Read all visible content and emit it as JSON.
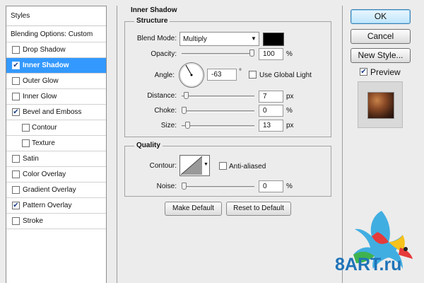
{
  "styles_panel": {
    "header": "Styles",
    "blending_options": "Blending Options: Custom",
    "items": [
      {
        "label": "Drop Shadow",
        "checked": false,
        "selected": false,
        "sub": false
      },
      {
        "label": "Inner Shadow",
        "checked": true,
        "selected": true,
        "sub": false
      },
      {
        "label": "Outer Glow",
        "checked": false,
        "selected": false,
        "sub": false
      },
      {
        "label": "Inner Glow",
        "checked": false,
        "selected": false,
        "sub": false
      },
      {
        "label": "Bevel and Emboss",
        "checked": true,
        "selected": false,
        "sub": false
      },
      {
        "label": "Contour",
        "checked": false,
        "selected": false,
        "sub": true
      },
      {
        "label": "Texture",
        "checked": false,
        "selected": false,
        "sub": true
      },
      {
        "label": "Satin",
        "checked": false,
        "selected": false,
        "sub": false
      },
      {
        "label": "Color Overlay",
        "checked": false,
        "selected": false,
        "sub": false
      },
      {
        "label": "Gradient Overlay",
        "checked": false,
        "selected": false,
        "sub": false
      },
      {
        "label": "Pattern Overlay",
        "checked": true,
        "selected": false,
        "sub": false
      },
      {
        "label": "Stroke",
        "checked": false,
        "selected": false,
        "sub": false
      }
    ]
  },
  "inner_shadow": {
    "title": "Inner Shadow",
    "structure": {
      "title": "Structure",
      "blend_mode_label": "Blend Mode:",
      "blend_mode_value": "Multiply",
      "color": "#000000",
      "opacity_label": "Opacity:",
      "opacity_value": "100",
      "opacity_unit": "%",
      "opacity_level": 1.0,
      "angle_label": "Angle:",
      "angle_value": "-63",
      "angle_unit": "°",
      "use_global_light_label": "Use Global Light",
      "use_global_light": false,
      "distance_label": "Distance:",
      "distance_value": "7",
      "distance_unit": "px",
      "distance_level": 0.03,
      "choke_label": "Choke:",
      "choke_value": "0",
      "choke_unit": "%",
      "choke_level": 0.0,
      "size_label": "Size:",
      "size_value": "13",
      "size_unit": "px",
      "size_level": 0.05
    },
    "quality": {
      "title": "Quality",
      "contour_label": "Contour:",
      "anti_aliased_label": "Anti-aliased",
      "anti_aliased": false,
      "noise_label": "Noise:",
      "noise_value": "0",
      "noise_unit": "%",
      "noise_level": 0.0
    },
    "make_default_label": "Make Default",
    "reset_to_default_label": "Reset to Default"
  },
  "actions": {
    "ok_label": "OK",
    "cancel_label": "Cancel",
    "new_style_label": "New Style...",
    "preview_label": "Preview",
    "preview_checked": true
  },
  "watermark": {
    "text": "8ART.ru"
  },
  "colors": {
    "selection": "#3399ff",
    "panel_bg": "#ececec"
  }
}
